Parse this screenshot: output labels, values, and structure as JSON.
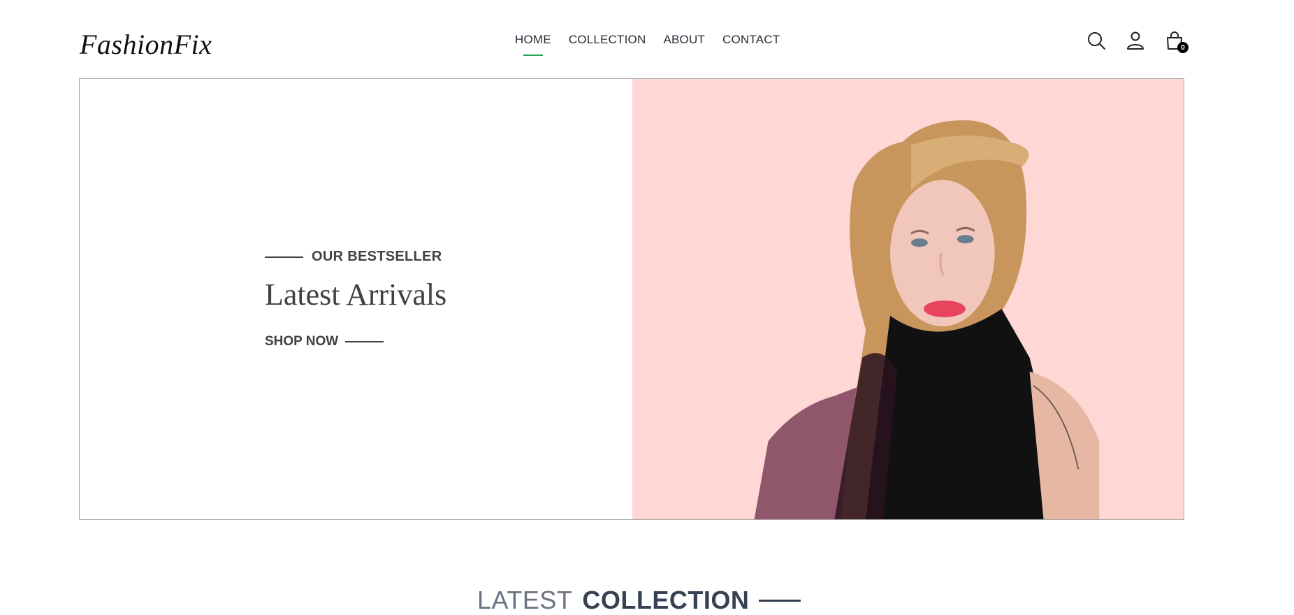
{
  "brand": {
    "logo_text": "FashionFix"
  },
  "nav": {
    "items": [
      {
        "label": "HOME",
        "active": true
      },
      {
        "label": "COLLECTION",
        "active": false
      },
      {
        "label": "ABOUT",
        "active": false
      },
      {
        "label": "CONTACT",
        "active": false
      }
    ],
    "active_color": "#1fa84f"
  },
  "header_icons": {
    "search": "search-icon",
    "profile": "user-icon",
    "cart": "shopping-bag-icon",
    "cart_count": "0"
  },
  "hero": {
    "eyebrow": "OUR BESTSELLER",
    "title": "Latest Arrivals",
    "cta": "SHOP NOW",
    "image_background": "#ffd8d6",
    "image_subject": "model-portrait"
  },
  "latest_collection": {
    "title_light": "LATEST",
    "title_bold": "COLLECTION"
  }
}
